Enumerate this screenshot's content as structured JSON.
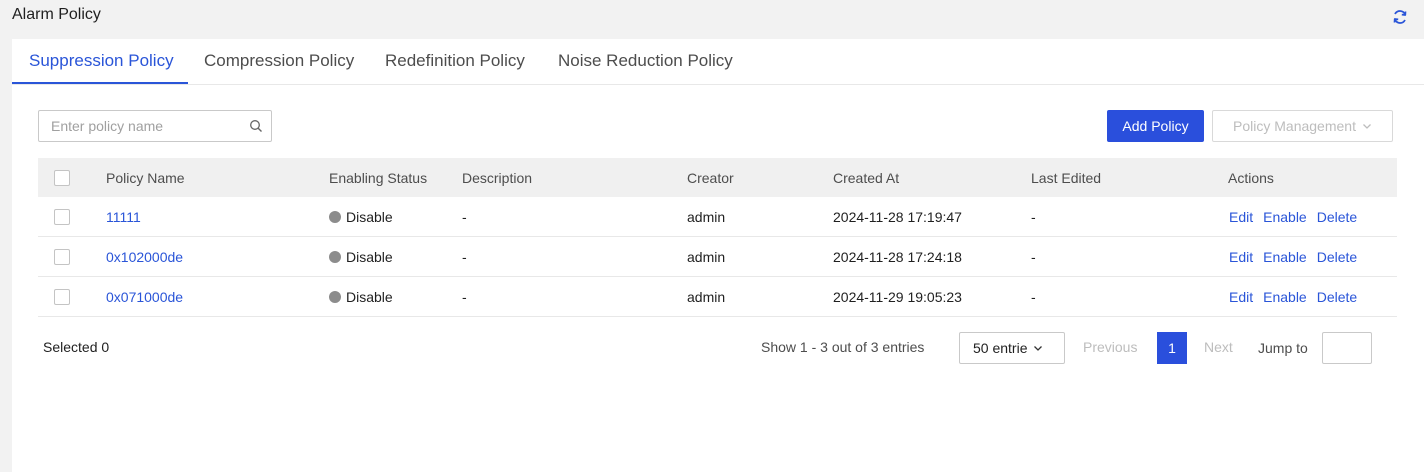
{
  "page": {
    "title": "Alarm Policy"
  },
  "icons": {
    "refresh": "refresh-icon",
    "search": "search-icon",
    "dropdown": "chevron-down-icon"
  },
  "colors": {
    "accent": "#2a55d8",
    "primary_button": "#2a4fdc",
    "status_disabled": "#8c8c8c"
  },
  "tabs": [
    {
      "label": "Suppression Policy",
      "active": true
    },
    {
      "label": "Compression Policy",
      "active": false
    },
    {
      "label": "Redefinition Policy",
      "active": false
    },
    {
      "label": "Noise Reduction Policy",
      "active": false
    }
  ],
  "toolbar": {
    "search_placeholder": "Enter policy name",
    "search_value": "",
    "add_label": "Add Policy",
    "manage_label": "Policy Management"
  },
  "table": {
    "columns": [
      "Policy Name",
      "Enabling Status",
      "Description",
      "Creator",
      "Created At",
      "Last Edited",
      "Actions"
    ],
    "rows": [
      {
        "name": "11111",
        "status": "Disable",
        "description": "-",
        "creator": "admin",
        "created_at": "2024-11-28 17:19:47",
        "last_edited": "-"
      },
      {
        "name": "0x102000de",
        "status": "Disable",
        "description": "-",
        "creator": "admin",
        "created_at": "2024-11-28 17:24:18",
        "last_edited": "-"
      },
      {
        "name": "0x071000de",
        "status": "Disable",
        "description": "-",
        "creator": "admin",
        "created_at": "2024-11-29 19:05:23",
        "last_edited": "-"
      }
    ],
    "actions": {
      "edit": "Edit",
      "enable": "Enable",
      "delete": "Delete"
    }
  },
  "footer": {
    "selected": "Selected 0",
    "info": "Show 1 - 3 out of 3 entries",
    "page_size": "50 entrie",
    "previous": "Previous",
    "current_page": "1",
    "next": "Next",
    "jump_label": "Jump to"
  }
}
